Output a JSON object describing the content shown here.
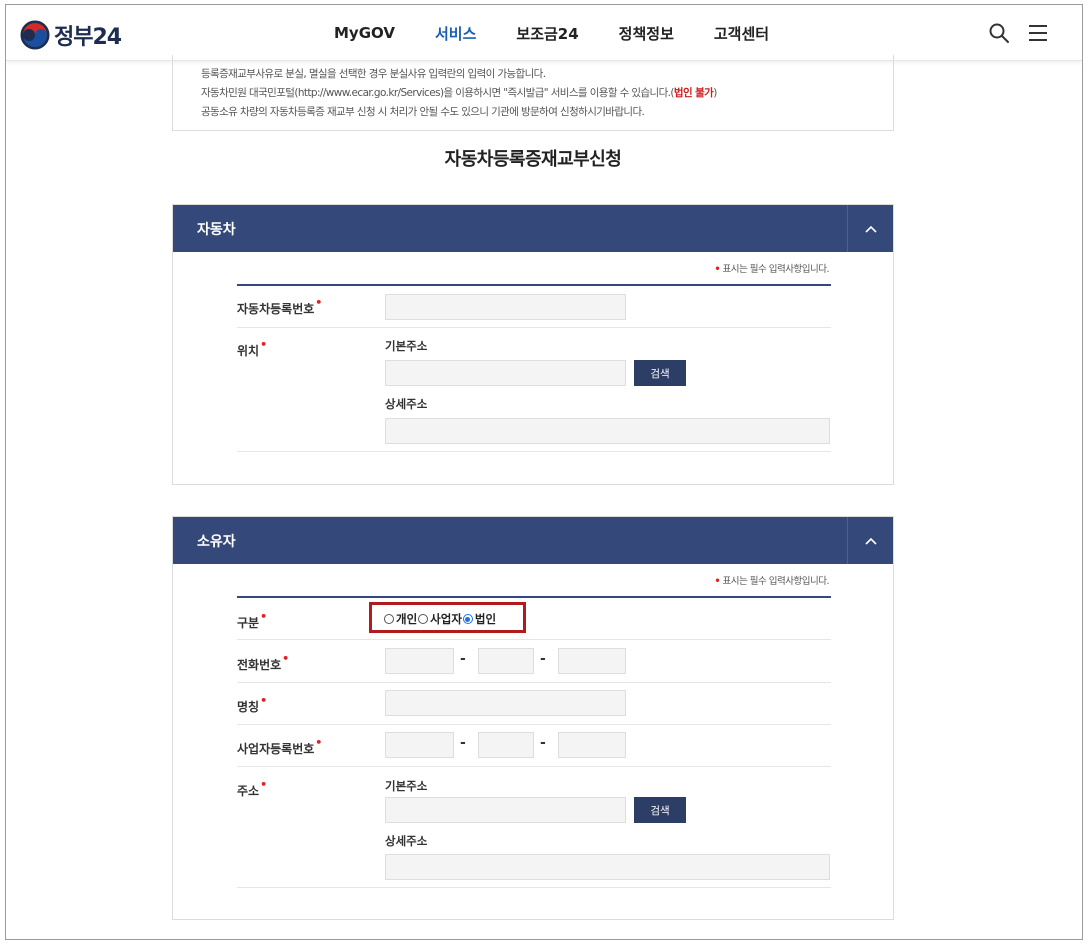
{
  "header": {
    "logo_text": "정부24",
    "nav": [
      "MyGOV",
      "서비스",
      "보조금24",
      "정책정보",
      "고객센터"
    ],
    "active_nav": "서비스",
    "icons": [
      "search-icon",
      "menu-icon"
    ]
  },
  "notice": {
    "line1": "등록증재교부사유로 분실, 멸실을 선택한 경우 분실사유 입력란의 입력이 가능합니다.",
    "line2_pre": "자동차민원 대국민포털(http://www.ecar.go.kr/Services)을 이용하시면 \"즉시발급\" 서비스를 이용할 수 있습니다.(",
    "line2_red": "법인 불가",
    "line2_post": ")",
    "line3": "공동소유 차량의 자동차등록증 재교부 신청 시 처리가 안될 수도 있으니 기관에 방문하여 신청하시기바랍니다."
  },
  "page_title": "자동차등록증재교부신청",
  "required_mark": "•",
  "required_note": "표시는 필수 입력사항입니다.",
  "vehicle": {
    "title": "자동차",
    "reg_no_label": "자동차등록번호",
    "location_label": "위치",
    "base_addr_label": "기본주소",
    "detail_addr_label": "상세주소",
    "search_btn": "검색"
  },
  "owner": {
    "title": "소유자",
    "type_label": "구분",
    "type_options": [
      "개인",
      "사업자",
      "법인"
    ],
    "type_selected": "법인",
    "phone_label": "전화번호",
    "name_label": "명칭",
    "biz_no_label": "사업자등록번호",
    "address_label": "주소",
    "base_addr_label": "기본주소",
    "detail_addr_label": "상세주소",
    "search_btn": "검색",
    "dash": "-"
  },
  "colors": {
    "section_header": "#34497a",
    "button": "#2c3e66",
    "required": "#e01f1f",
    "highlight_border": "#b01c1c",
    "active_nav": "#1a5fb4"
  }
}
